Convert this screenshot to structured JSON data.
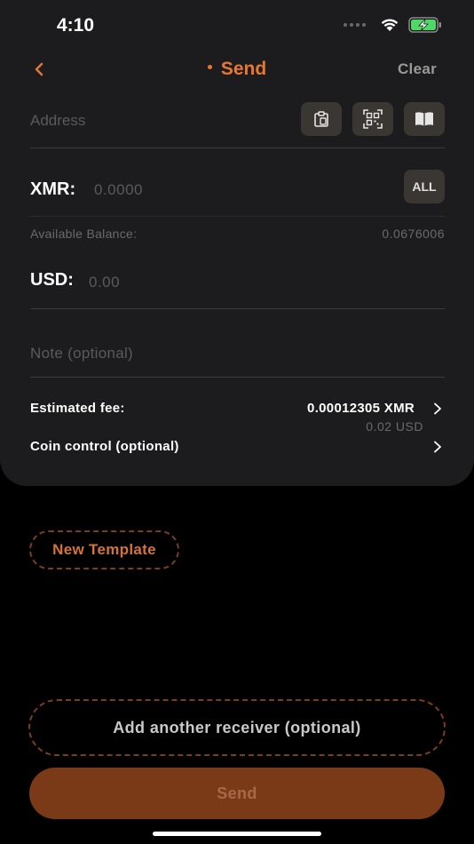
{
  "status_bar": {
    "time": "4:10"
  },
  "nav": {
    "title": "Send",
    "clear_label": "Clear"
  },
  "address": {
    "placeholder": "Address"
  },
  "xmr": {
    "label": "XMR:",
    "placeholder": "0.0000",
    "all_label": "ALL"
  },
  "balance": {
    "label": "Available Balance:",
    "value": "0.0676006"
  },
  "usd": {
    "label": "USD:",
    "placeholder": "0.00"
  },
  "note": {
    "placeholder": "Note (optional)"
  },
  "fee": {
    "label": "Estimated fee:",
    "value": "0.00012305 XMR",
    "usd_value": "0.02 USD"
  },
  "coin_control": {
    "label": "Coin control (optional)"
  },
  "buttons": {
    "new_template": "New Template",
    "add_receiver": "Add another receiver (optional)",
    "send": "Send"
  },
  "colors": {
    "accent": "#e8782f",
    "card_background": "#1c1c1e",
    "send_button": "#7b3a17",
    "dashed_border": "#7a3e1c"
  },
  "icons": [
    "back-chevron-icon",
    "paste-icon",
    "qr-scan-icon",
    "address-book-icon",
    "chevron-right-icon",
    "wifi-icon",
    "battery-charging-icon"
  ]
}
